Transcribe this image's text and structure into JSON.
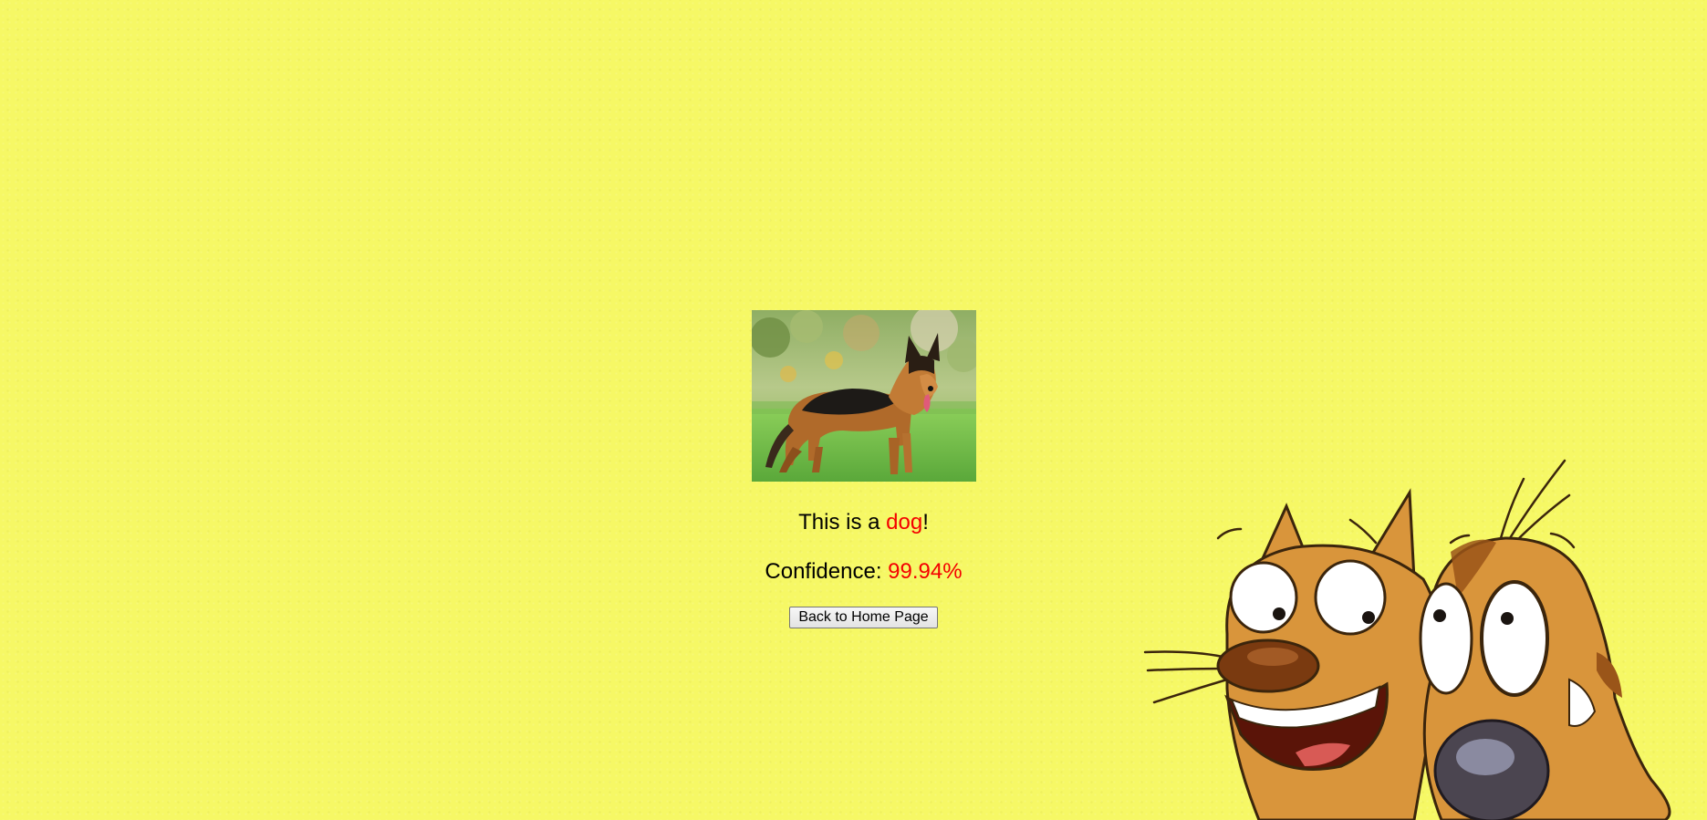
{
  "result": {
    "prefix": "This is a ",
    "label": "dog",
    "suffix": "!",
    "confidence_label": "Confidence: ",
    "confidence_value": "99.94%"
  },
  "button": {
    "label": "Back to Home Page"
  },
  "colors": {
    "background": "#f6f865",
    "highlight": "#f40000",
    "cartoon_fur": "#d9953b"
  },
  "images": {
    "photo": "german-shepherd-dog-photo",
    "decoration": "cartoon-cat-and-dog-characters"
  }
}
